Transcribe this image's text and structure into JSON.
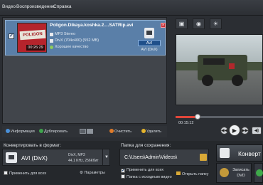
{
  "menu": [
    "Видео",
    "Воспроизведение",
    "Справка"
  ],
  "file": {
    "checked": true,
    "thumb_logo": "POLIGON",
    "duration": "00:26:29",
    "name": "Poligon.Dikaya.koshka.2....SATRip.avi",
    "audio": "MP3 Stereo",
    "video": "DivX (704x400) (552 MB)",
    "quality": "Хорошее качество",
    "format_badge": "AVI",
    "format_label": "AVI (DivX)"
  },
  "toolbar": {
    "info": "Информация",
    "duplicate": "Дублировать",
    "clear": "Очистить",
    "delete": "Удалить"
  },
  "player": {
    "time": "00:15:12",
    "progress": 0.25
  },
  "convert_format": {
    "label": "Конвертировать в формат:",
    "name": "AVI (DivX)",
    "details": [
      "DivX, MP3",
      "44,1 KHz, 256Кбит"
    ],
    "apply_all": "Применить для всех",
    "params": "Параметры"
  },
  "save_folder": {
    "label": "Папка для сохранения:",
    "path": "C:\\Users\\Admin\\Videos\\",
    "apply_all": "Применить для всех",
    "apply_all_checked": true,
    "source_folder": "Папка с исходным видео",
    "open_folder": "Открыть папку"
  },
  "actions": {
    "convert": "Конверт",
    "burn_dvd": [
      "Записать",
      "DVD"
    ]
  },
  "colors": {
    "accent_red": "#e0463a",
    "selection_blue": "#5a7fa8",
    "badge_blue": "#1f4f8a"
  }
}
